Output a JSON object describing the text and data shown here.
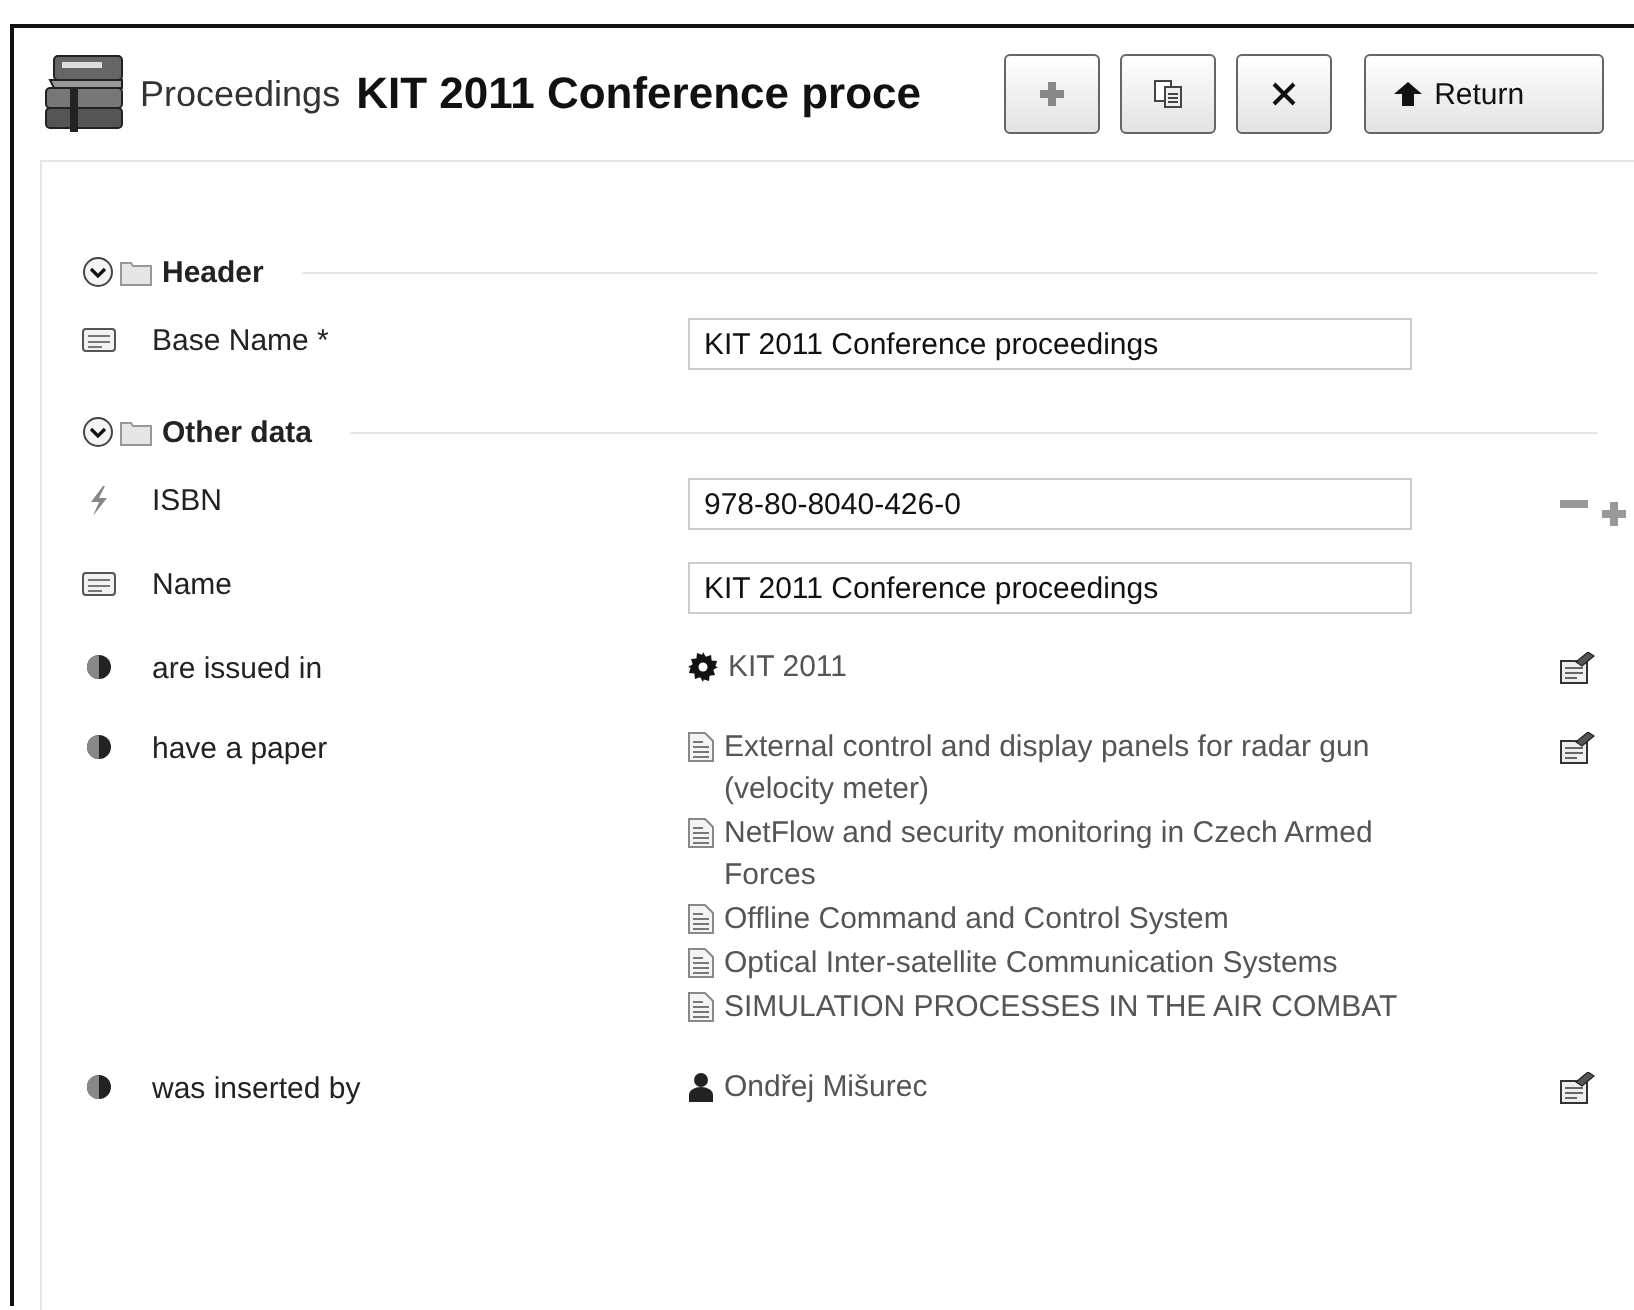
{
  "header": {
    "entity_type": "Proceedings",
    "title": "KIT 2011 Conference proce"
  },
  "toolbar": [
    {
      "kind": "add"
    },
    {
      "kind": "copy"
    },
    {
      "kind": "delete"
    },
    {
      "kind": "return",
      "label": "Return"
    }
  ],
  "sections": [
    {
      "title": "Header",
      "expanded": true,
      "rows": [
        {
          "kind": "text",
          "label": "Base Name *",
          "value": "KIT 2011 Conference proceedings"
        }
      ]
    },
    {
      "title": "Other data",
      "expanded": true,
      "rows": [
        {
          "kind": "identifier",
          "label": "ISBN",
          "value": "978-80-8040-426-0"
        },
        {
          "kind": "text",
          "label": "Name",
          "value": "KIT 2011 Conference proceedings"
        },
        {
          "kind": "relation",
          "label": "are issued in",
          "items": [
            {
              "kind": "event",
              "text": "KIT 2011"
            }
          ]
        },
        {
          "kind": "relation",
          "label": "have a paper",
          "items": [
            {
              "kind": "paper",
              "text": "External control and display panels for radar gun (velocity meter)"
            },
            {
              "kind": "paper",
              "text": "NetFlow and security monitoring in Czech Armed Forces"
            },
            {
              "kind": "paper",
              "text": "Offline Command and Control System"
            },
            {
              "kind": "paper",
              "text": "Optical Inter-satellite Communication Systems"
            },
            {
              "kind": "paper",
              "text": "SIMULATION PROCESSES IN THE AIR COMBAT"
            }
          ]
        },
        {
          "kind": "relation",
          "label": "was inserted by",
          "items": [
            {
              "kind": "person",
              "text": "Ondřej Mišurec"
            }
          ]
        }
      ]
    }
  ]
}
